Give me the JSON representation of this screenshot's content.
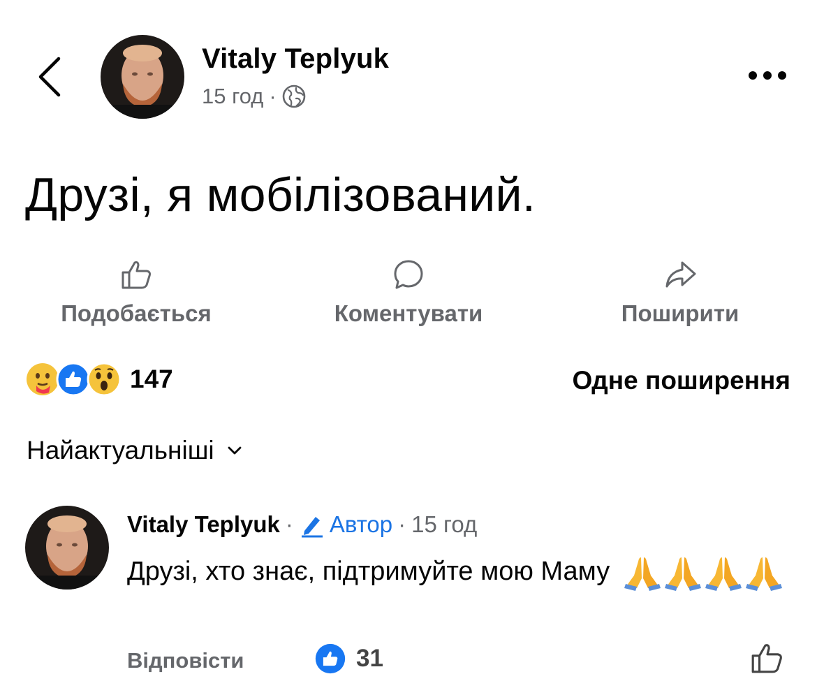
{
  "post": {
    "author": "Vitaly  Teplyuk",
    "time": "15 год",
    "dot": "·",
    "text": "Друзі, я мобілізований."
  },
  "actions": {
    "like": "Подобається",
    "comment": "Коментувати",
    "share": "Поширити"
  },
  "stats": {
    "reaction_icons": [
      "care-icon",
      "like-icon",
      "wow-icon"
    ],
    "reaction_count": "147",
    "shares": "Одне поширення"
  },
  "sort": {
    "label": "Найактуальніші"
  },
  "comment": {
    "author": "Vitaly  Teplyuk",
    "badge": "Автор",
    "time": "15 год",
    "sep": "·",
    "text": "Друзі,  хто знає, підтримуйте мою Маму",
    "prayer_emoji_count": 4,
    "reply": "Відповісти",
    "likes": "31"
  },
  "colors": {
    "accent": "#1b74e4",
    "secondary": "#65676b",
    "text": "#050505"
  }
}
